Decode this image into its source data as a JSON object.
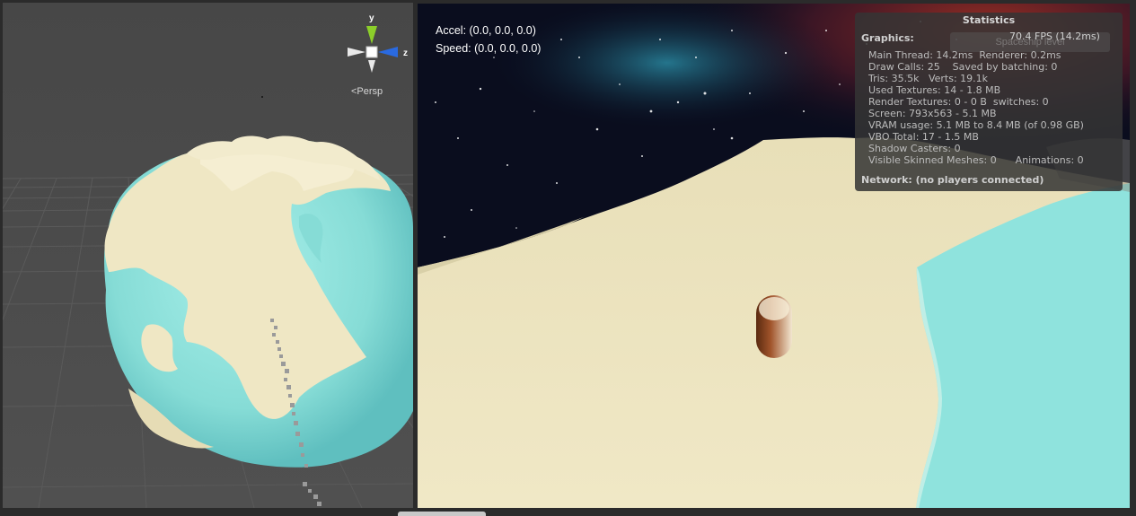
{
  "scene_view": {
    "projection_label": "<Persp",
    "gizmo": {
      "y_axis": "y",
      "z_axis": "z"
    }
  },
  "game_view": {
    "accel_text": "Accel: (0.0, 0.0, 0.0)",
    "speed_text": "Speed: (0.0, 0.0, 0.0)"
  },
  "statistics": {
    "title": "Statistics",
    "ghost_button_label": "Spaceship level",
    "fps": "70.4 FPS (14.2ms)",
    "graphics_header": "Graphics:",
    "rows": [
      "Main Thread: 14.2ms  Renderer: 0.2ms",
      "Draw Calls: 25    Saved by batching: 0",
      "Tris: 35.5k   Verts: 19.1k",
      "Used Textures: 14 - 1.8 MB",
      "Render Textures: 0 - 0 B  switches: 0",
      "Screen: 793x563 - 5.1 MB",
      "VRAM usage: 5.1 MB to 8.4 MB (of 0.98 GB)",
      "VBO Total: 17 - 1.5 MB",
      "Shadow Casters: 0",
      "Visible Skinned Meshes: 0      Animations: 0"
    ],
    "network": "Network: (no players connected)"
  },
  "colors": {
    "ocean": "#8fe3dd",
    "land": "#efe7c4",
    "scene_bg": "#4a4a4a",
    "space": "#0a0d1e",
    "gizmo_y": "#8ccf2a",
    "gizmo_z": "#2a6ae0"
  }
}
